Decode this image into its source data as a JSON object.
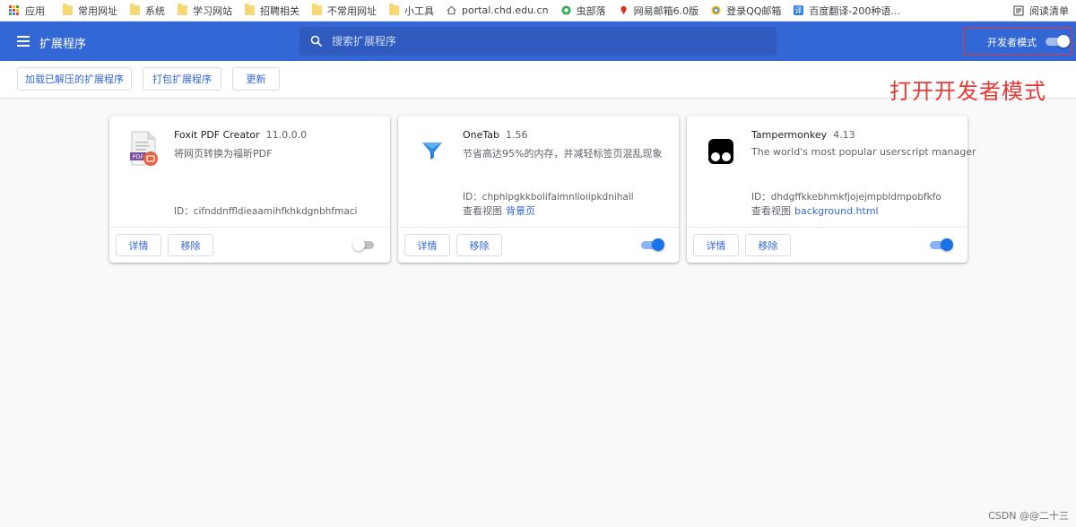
{
  "bookmarks": {
    "items": [
      {
        "label": "应用",
        "icon": "apps-grid-icon"
      },
      {
        "label": "常用网址",
        "icon": "folder-icon"
      },
      {
        "label": "系统",
        "icon": "folder-icon"
      },
      {
        "label": "学习网站",
        "icon": "folder-icon"
      },
      {
        "label": "招聘相关",
        "icon": "folder-icon"
      },
      {
        "label": "不常用网址",
        "icon": "folder-icon"
      },
      {
        "label": "小工具",
        "icon": "folder-icon"
      },
      {
        "label": "portal.chd.edu.cn",
        "icon": "home-icon"
      },
      {
        "label": "虫部落",
        "icon": "bug-tribe-icon"
      },
      {
        "label": "网易邮箱6.0版",
        "icon": "netease-mail-icon"
      },
      {
        "label": "登录QQ邮箱",
        "icon": "qq-mail-icon"
      },
      {
        "label": "百度翻译-200种语...",
        "icon": "baidu-translate-icon"
      }
    ],
    "reading_list": "阅读清单"
  },
  "header": {
    "title": "扩展程序",
    "search_placeholder": "搜索扩展程序",
    "dev_mode_label": "开发者模式",
    "dev_mode_on": true
  },
  "toolbar": {
    "load_unpacked": "加载已解压的扩展程序",
    "pack_extension": "打包扩展程序",
    "update": "更新"
  },
  "annotation": "打开开发者模式",
  "colors": {
    "header_bg": "#3367d6",
    "accent": "#1a73e8",
    "annotation_red": "#e53935"
  },
  "extensions": [
    {
      "name": "Foxit PDF Creator",
      "version": "11.0.0.0",
      "description": "将网页转换为福昕PDF",
      "id": "ID：cifnddnffldieaamihfkhkdgnbhfmaci",
      "views_label": "",
      "views_link": "",
      "details": "详情",
      "remove": "移除",
      "enabled": false,
      "icon": "foxit-pdf-icon"
    },
    {
      "name": "OneTab",
      "version": "1.56",
      "description": "节省高达95%的内存，并减轻标签页混乱现象",
      "id": "ID：chphlpgkkbolifaimnlloiipkdnihall",
      "views_label": "查看视图",
      "views_link": "背景页",
      "details": "详情",
      "remove": "移除",
      "enabled": true,
      "icon": "onetab-funnel-icon"
    },
    {
      "name": "Tampermonkey",
      "version": "4.13",
      "description": "The world's most popular userscript manager",
      "id": "ID：dhdgffkkebhmkfjojejmpbldmpobfkfo",
      "views_label": "查看视图",
      "views_link": "background.html",
      "details": "详情",
      "remove": "移除",
      "enabled": true,
      "icon": "tampermonkey-icon"
    }
  ],
  "watermark": "CSDN @@二十三"
}
